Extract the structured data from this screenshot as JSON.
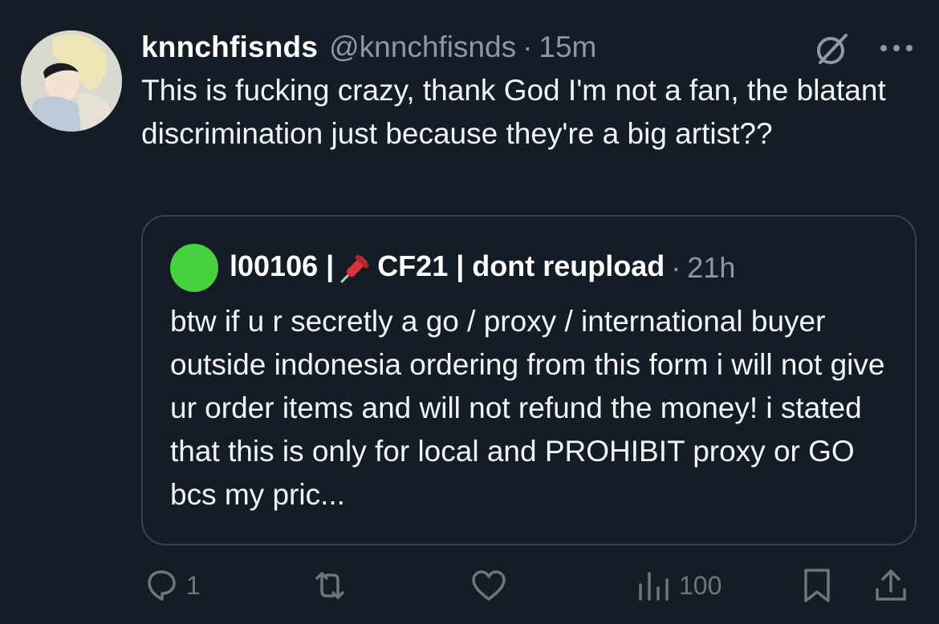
{
  "tweet": {
    "display_name": "knnchfisnds",
    "handle": "@knnchfisnds",
    "separator": "·",
    "time": "15m",
    "text": "This is fucking crazy, thank God I'm not a fan, the blatant discrimination just because they're a big artist??"
  },
  "quoted": {
    "name_part1": "l00106 |",
    "name_part2": "CF21 | dont reupload",
    "separator": "·",
    "time": "21h",
    "text": "btw if u r secretly a go / proxy / international buyer outside indonesia ordering from this form i will not give ur order items and will not refund the money! i stated that this is only for local and PROHIBIT proxy or GO bcs my pric..."
  },
  "actions": {
    "reply_count": "1",
    "repost_count": "",
    "like_count": "",
    "views_count": "100"
  },
  "colors": {
    "background": "#141d26",
    "secondary_text": "#8b98a5",
    "icon": "#6e767d",
    "border": "#38444d",
    "quoted_avatar": "#46d23e"
  },
  "icons": [
    "grok-icon",
    "more-icon",
    "pushpin-icon",
    "reply-icon",
    "repost-icon",
    "like-icon",
    "views-icon",
    "bookmark-icon",
    "share-icon"
  ]
}
